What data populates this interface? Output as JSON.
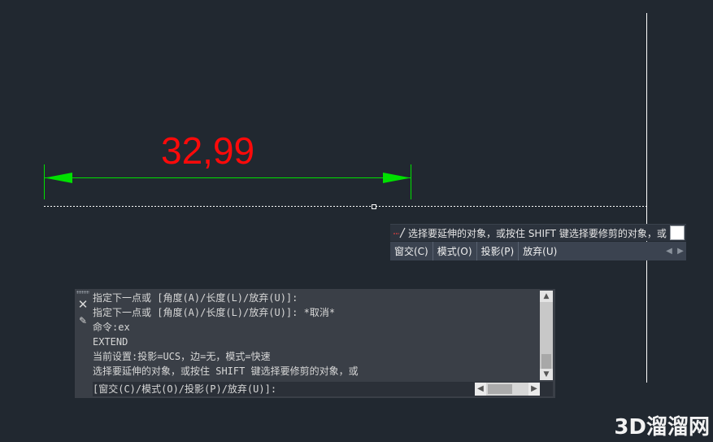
{
  "drawing": {
    "dimension_value": "32,99",
    "dimension_color": "#ff0a0a",
    "dimension_line_color": "#00e000",
    "crosshair_color": "#ffffff"
  },
  "dynamic_input": {
    "prompt": "选择要延伸的对象，或按住 SHIFT 键选择要修剪的对象，或",
    "prompt_icon": "extend-icon",
    "options": [
      "窗交(C)",
      "模式(O)",
      "投影(P)",
      "放弃(U)"
    ]
  },
  "command_line": {
    "history": [
      "指定下一点或 [角度(A)/长度(L)/放弃(U)]:",
      "指定下一点或 [角度(A)/长度(L)/放弃(U)]: *取消*",
      "命令:ex",
      "EXTEND",
      "当前设置:投影=UCS，边=无，模式=快速",
      "选择要延伸的对象，或按住 SHIFT 键选择要修剪的对象，或"
    ],
    "input": "[窗交(C)/模式(O)/投影(P)/放弃(U)]:",
    "close_icon": "close-icon",
    "customize_icon": "pen-icon"
  },
  "watermark": "3D溜溜网"
}
